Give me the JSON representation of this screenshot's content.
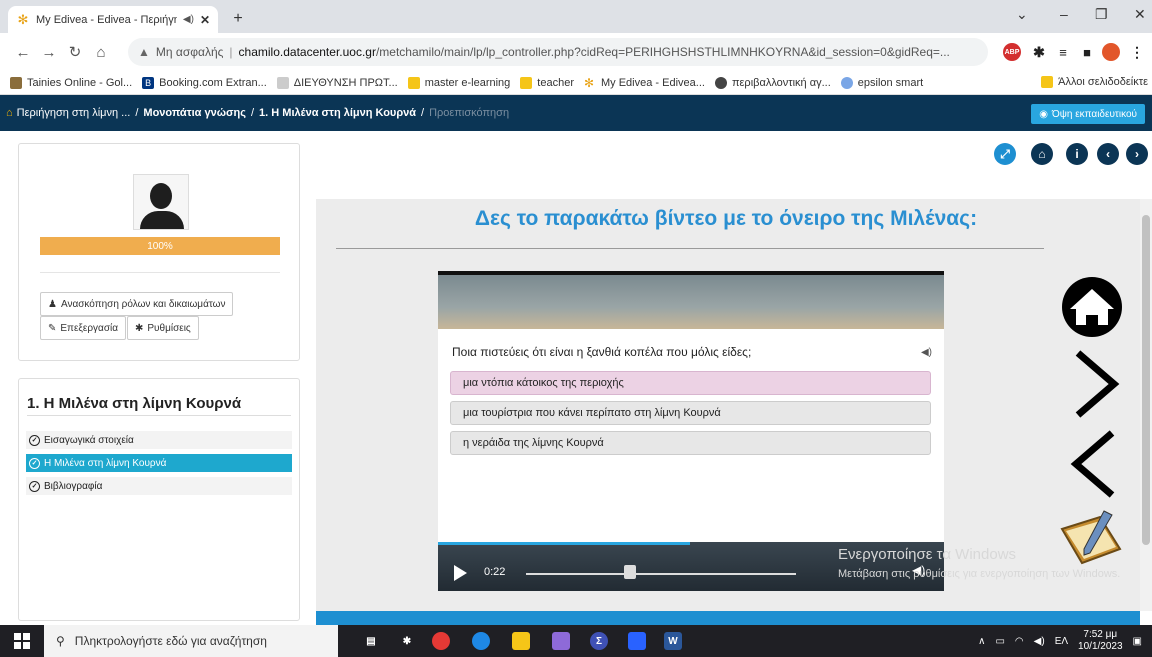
{
  "browser": {
    "tab_title": "My Edivea - Edivea - Περιήγη",
    "url_warning": "Μη ασφαλής",
    "url_host": "chamilo.datacenter.uoc.gr",
    "url_path": "/metchamilo/main/lp/lp_controller.php?cidReq=PERIHGHSHSTHLIMNHKOYRNA&id_session=0&gidReq=...",
    "bookmarks": [
      "Tainies Online - Gol...",
      "Booking.com Extran...",
      "ΔΙΕΥΘΥΝΣΗ ΠΡΩΤ...",
      "master e-learning",
      "teacher",
      "My Edivea - Edivea...",
      "περιβαλλοντική αγ...",
      "epsilon smart"
    ],
    "bookmarks_other": "Άλλοι σελιδοδείκτε"
  },
  "header": {
    "crumb1": "Περιήγηση στη λίμνη ...",
    "crumb2": "Μονοπάτια γνώσης",
    "crumb3": "1. Η Μιλένα στη λίμνη Κουρνά",
    "crumb4": "Προεπισκόπηση",
    "teacher_view": "Όψη εκπαιδευτικού"
  },
  "sidebar": {
    "progress": "100%",
    "progress_value": 1.0,
    "roles_button": "Ανασκόπηση ρόλων και δικαιωμάτων",
    "edit_button": "Επεξεργασία",
    "settings_button": "Ρυθμίσεις",
    "lp_title": "1. Η Μιλένα στη λίμνη Κουρνά",
    "items": [
      {
        "label": "Εισαγωγικά στοιχεία"
      },
      {
        "label": "Η Μιλένα στη λίμνη Κουρνά"
      },
      {
        "label": "Βιβλιογραφία"
      }
    ]
  },
  "lesson": {
    "title": "Δες το παρακάτω βίντεο με το όνειρο της Μιλένας:",
    "question": "Ποια πιστεύεις ότι είναι η ξανθιά κοπέλα που μόλις είδες;",
    "options": [
      "μια ντόπια κάτοικος της περιοχής",
      "μια τουρίστρια που κάνει περίπατο στη λίμνη Κουρνά",
      "η νεράιδα της λίμνης Κουρνά"
    ],
    "time": "0:22",
    "video_progress": 0.5
  },
  "watermark": {
    "line1": "Ενεργοποίησε τα Windows",
    "line2": "Μετάβαση στις ρυθμίσεις για ενεργοποίηση των Windows."
  },
  "taskbar": {
    "search_placeholder": "Πληκτρολογήστε εδώ για αναζήτηση",
    "lang": "ΕΛ",
    "time": "7:52 μμ",
    "date": "10/1/2023"
  },
  "colors": {
    "header_bg": "#0b3555",
    "accent": "#29a6e0",
    "progress": "#f0ad4e",
    "active_item": "#1ea8ce"
  }
}
